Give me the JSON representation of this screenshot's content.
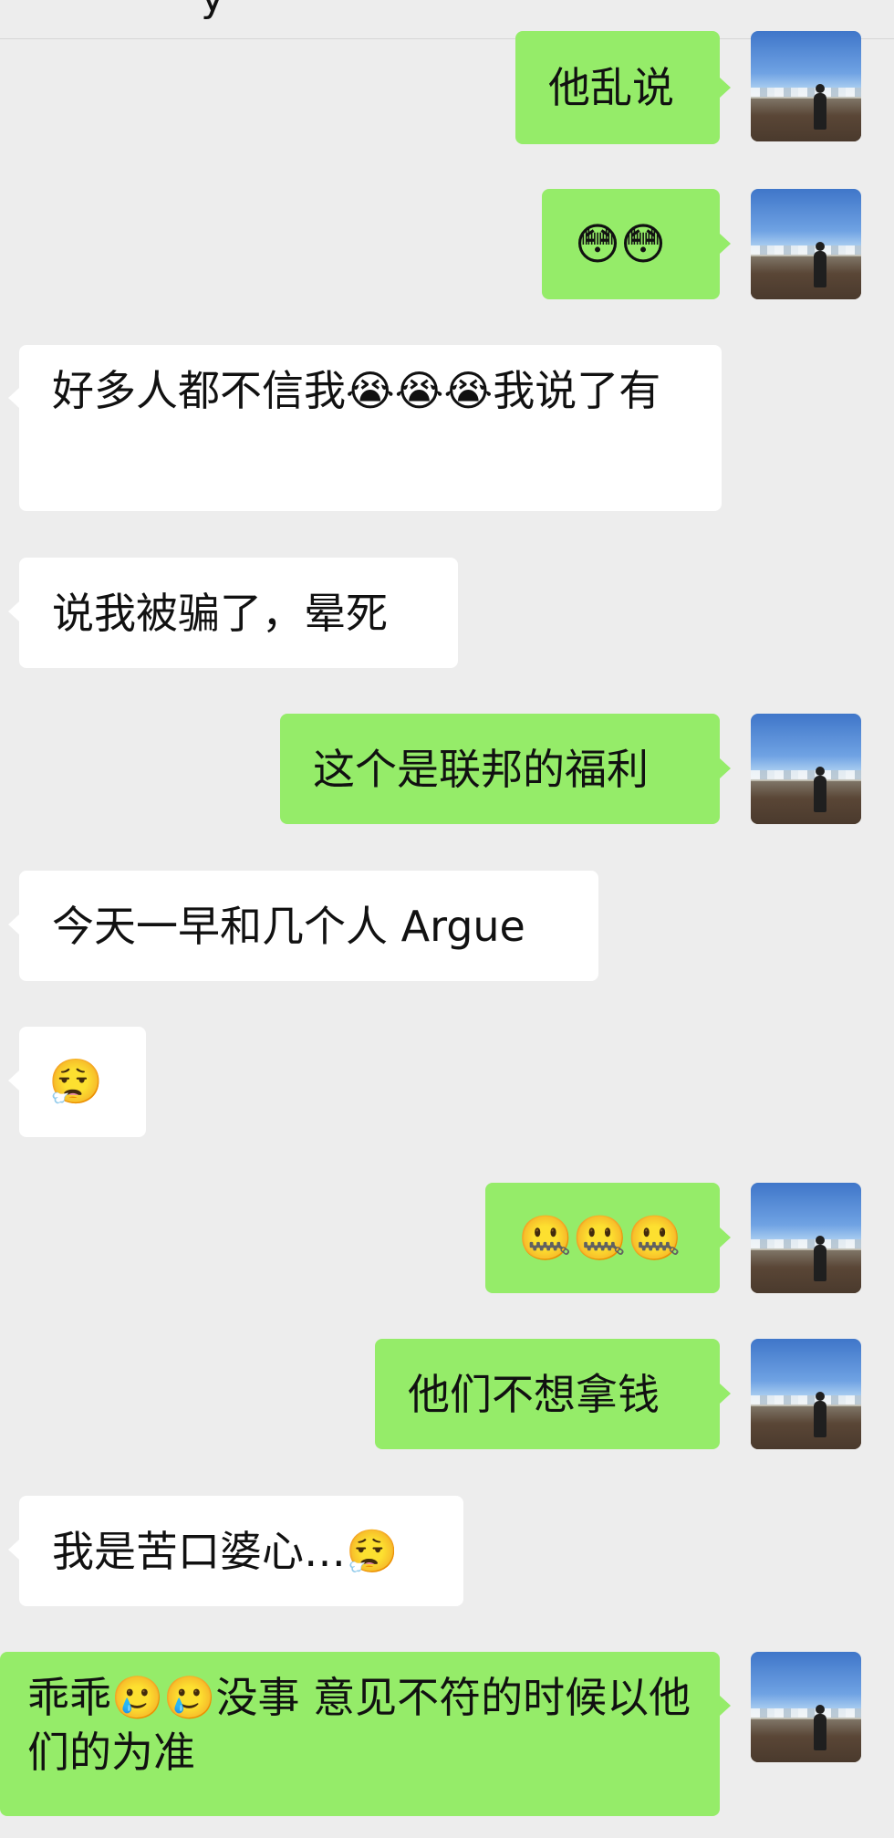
{
  "header": {
    "title": "y"
  },
  "messages": [
    {
      "side": "out",
      "text": "他乱说"
    },
    {
      "side": "out",
      "text": "😳😳"
    },
    {
      "side": "in",
      "text": "好多人都不信我😭😭😭我说了有"
    },
    {
      "side": "in",
      "text": "说我被骗了，晕死"
    },
    {
      "side": "out",
      "text": "这个是联邦的福利"
    },
    {
      "side": "in",
      "text": "今天一早和几个人 Argue"
    },
    {
      "side": "in",
      "text": "😮‍💨"
    },
    {
      "side": "out",
      "text": "🤐🤐🤐"
    },
    {
      "side": "out",
      "text": "他们不想拿钱"
    },
    {
      "side": "in",
      "text": "我是苦口婆心…😮‍💨"
    },
    {
      "side": "out",
      "text": "乖乖🥲🥲没事 意见不符的时候以他们的为准"
    }
  ],
  "colors": {
    "background": "#ededed",
    "outgoing_bubble": "#95ec69",
    "incoming_bubble": "#ffffff"
  },
  "icons": {
    "avatar": "profile-photo-landscape"
  }
}
